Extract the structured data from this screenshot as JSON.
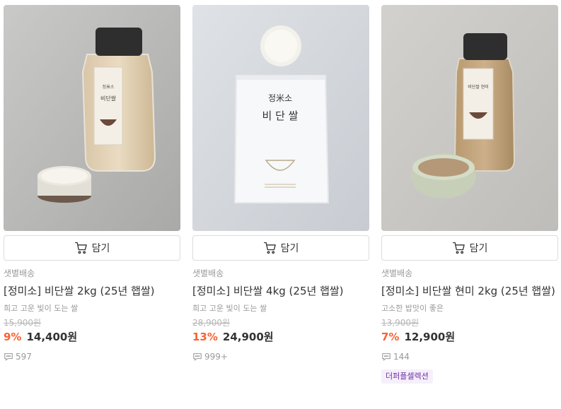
{
  "products": [
    {
      "cart_label": "담기",
      "shipping": "샛별배송",
      "name": "[정미소] 비단쌀 2kg (25년 햅쌀)",
      "description": "희고 고운 빛이 도는 쌀",
      "original_price": "15,900원",
      "discount": "9%",
      "price": "14,400원",
      "review_count": "597",
      "image_icon": "rice-jar-photo"
    },
    {
      "cart_label": "담기",
      "shipping": "샛별배송",
      "name": "[정미소] 비단쌀 4kg (25년 햅쌀)",
      "description": "희고 고운 빛이 도는 쌀",
      "original_price": "28,900원",
      "discount": "13%",
      "price": "24,900원",
      "review_count": "999+",
      "image_icon": "rice-bag-photo",
      "package_brand": "정米소",
      "package_name": "비 단 쌀"
    },
    {
      "cart_label": "담기",
      "shipping": "샛별배송",
      "name": "[정미소] 비단쌀 현미 2kg (25년 햅쌀)",
      "description": "고소한 밥맛이 좋은",
      "original_price": "13,900원",
      "discount": "7%",
      "price": "12,900원",
      "review_count": "144",
      "tag": "더퍼플셀렉션",
      "image_icon": "brown-rice-jar-photo"
    }
  ],
  "colors": {
    "discount": "#fa622f",
    "tag_bg": "#f5f0fa",
    "tag_text": "#6e2ea5"
  }
}
